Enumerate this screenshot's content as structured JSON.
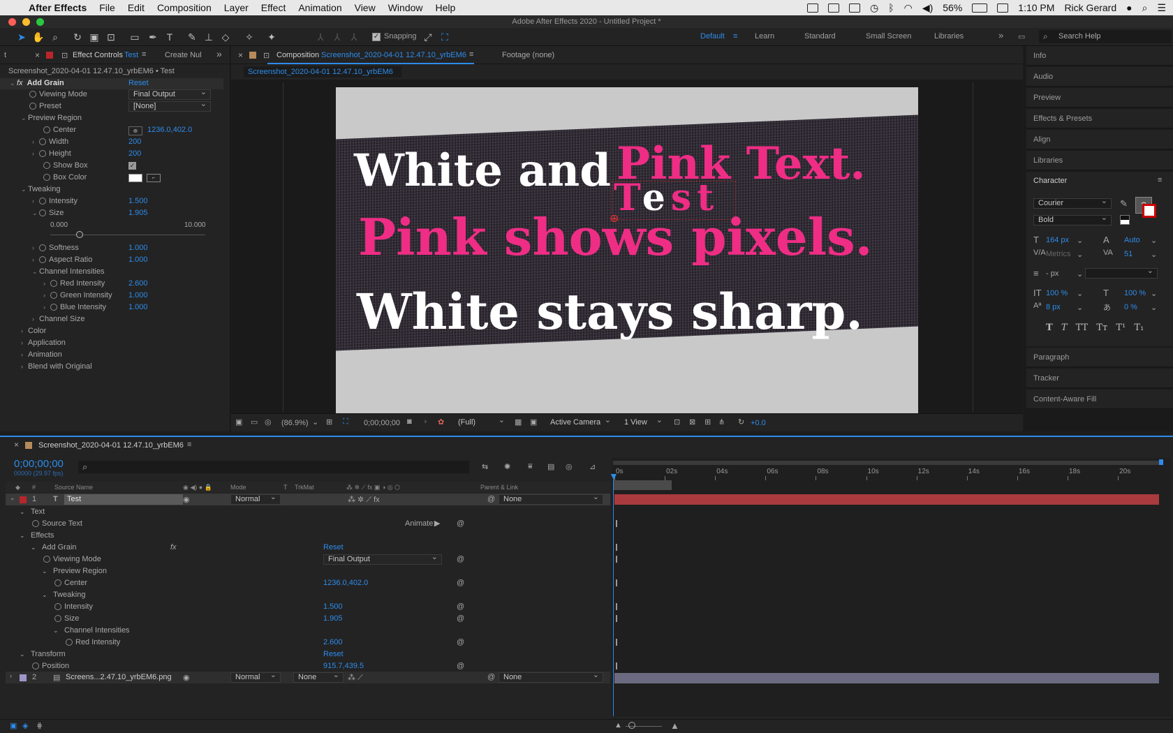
{
  "menubar": {
    "app": "After Effects",
    "items": [
      "File",
      "Edit",
      "Composition",
      "Layer",
      "Effect",
      "Animation",
      "View",
      "Window",
      "Help"
    ],
    "battery": "56%",
    "clock": "1:10 PM",
    "user": "Rick Gerard"
  },
  "window": {
    "title": "Adobe After Effects 2020 - Untitled Project *"
  },
  "toolbar": {
    "snapping": "Snapping",
    "workspaces": [
      "Default",
      "Learn",
      "Standard",
      "Small Screen",
      "Libraries"
    ],
    "search": "Search Help"
  },
  "effect_controls": {
    "tab_prefix": "Effect Controls",
    "tab_layer": "Test",
    "tab2": "Create Nul",
    "layer_path": "Screenshot_2020-04-01 12.47.10_yrbEM6 • Test",
    "effect": "Add Grain",
    "reset": "Reset",
    "rows": [
      {
        "label": "Viewing Mode",
        "value": "Final Output"
      },
      {
        "label": "Preset",
        "value": "[None]"
      },
      {
        "label": "Preview Region"
      },
      {
        "label": "Center",
        "value": "1236.0,402.0"
      },
      {
        "label": "Width",
        "value": "200"
      },
      {
        "label": "Height",
        "value": "200"
      },
      {
        "label": "Show Box"
      },
      {
        "label": "Box Color"
      },
      {
        "label": "Tweaking"
      },
      {
        "label": "Intensity",
        "value": "1.500"
      },
      {
        "label": "Size",
        "value": "1.905"
      },
      {
        "label": "Softness",
        "value": "1.000"
      },
      {
        "label": "Aspect Ratio",
        "value": "1.000"
      },
      {
        "label": "Channel Intensities"
      },
      {
        "label": "Red Intensity",
        "value": "2.600"
      },
      {
        "label": "Green Intensity",
        "value": "1.000"
      },
      {
        "label": "Blue Intensity",
        "value": "1.000"
      },
      {
        "label": "Channel Size"
      },
      {
        "label": "Color"
      },
      {
        "label": "Application"
      },
      {
        "label": "Animation"
      },
      {
        "label": "Blend with Original"
      }
    ],
    "slider_min": "0.000",
    "slider_max": "10.000",
    "size_slider": 0.19
  },
  "composition": {
    "tab_prefix": "Composition",
    "tab_name": "Screenshot_2020-04-01 12.47.10_yrbEM6",
    "footage": "Footage (none)",
    "subtab": "Screenshot_2020-04-01 12.47.10_yrbEM6",
    "text": {
      "line1_white": "White and",
      "line1_pink": "Pink Text.",
      "test": "Test",
      "line2": "Pink shows pixels.",
      "line3": "White stays sharp."
    },
    "bottom": {
      "zoom": "(86.9%)",
      "timecode": "0;00;00;00",
      "resolution": "(Full)",
      "camera": "Active Camera",
      "views": "1 View",
      "exposure": "+0.0"
    }
  },
  "right_panel": {
    "items_top": [
      "Info",
      "Audio",
      "Preview",
      "Effects & Presets",
      "Align",
      "Libraries"
    ],
    "character": "Character",
    "font": "Courier",
    "style": "Bold",
    "size": "164 px",
    "leading": "Auto",
    "kerning": "Metrics",
    "tracking": "51",
    "stroke": "- px",
    "vscale": "100 %",
    "hscale": "100 %",
    "baseline": "8 px",
    "tsume": "0 %",
    "items_bottom": [
      "Paragraph",
      "Tracker",
      "Content-Aware Fill"
    ]
  },
  "timeline": {
    "tab": "Screenshot_2020-04-01 12.47.10_yrbEM6",
    "timecode": "0;00;00;00",
    "fps": "00000 (29.97 fps)",
    "headers": {
      "num": "#",
      "source": "Source Name",
      "mode": "Mode",
      "t": "T",
      "trkmat": "TrkMat",
      "parent": "Parent & Link"
    },
    "ticks": [
      "0s",
      "02s",
      "04s",
      "06s",
      "08s",
      "10s",
      "12s",
      "14s",
      "16s",
      "18s",
      "20s"
    ],
    "layer1": {
      "num": "1",
      "name": "Test",
      "mode": "Normal",
      "parent": "None"
    },
    "props": [
      {
        "label": "Text",
        "indent": 1
      },
      {
        "label": "Source Text",
        "indent": 2,
        "animate": "Animate:"
      },
      {
        "label": "Effects",
        "indent": 1
      },
      {
        "label": "Add Grain",
        "indent": 2,
        "value": "Reset"
      },
      {
        "label": "Viewing Mode",
        "indent": 3,
        "value": "Final Output"
      },
      {
        "label": "Preview Region",
        "indent": 3
      },
      {
        "label": "Center",
        "indent": 4,
        "value": "1236.0,402.0"
      },
      {
        "label": "Tweaking",
        "indent": 3
      },
      {
        "label": "Intensity",
        "indent": 4,
        "value": "1.500"
      },
      {
        "label": "Size",
        "indent": 4,
        "value": "1.905"
      },
      {
        "label": "Channel Intensities",
        "indent": 4
      },
      {
        "label": "Red Intensity",
        "indent": 5,
        "value": "2.600"
      },
      {
        "label": "Transform",
        "indent": 1,
        "value": "Reset"
      },
      {
        "label": "Position",
        "indent": 2,
        "value": "915.7,439.5"
      }
    ],
    "layer2": {
      "num": "2",
      "name": "Screens...2.47.10_yrbEM6.png",
      "mode": "Normal",
      "trkmat": "None",
      "parent": "None"
    }
  }
}
